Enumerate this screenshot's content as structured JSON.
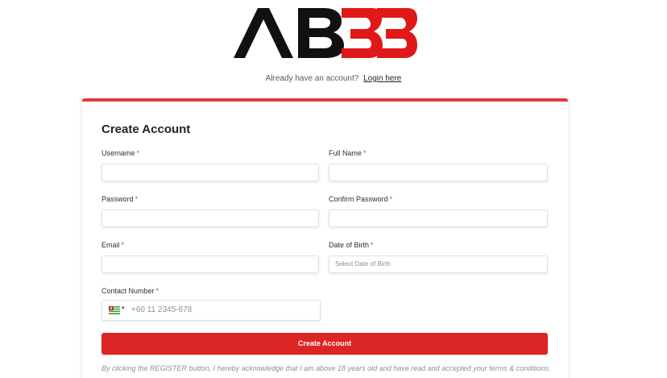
{
  "brand": {
    "logo_text_dark": "AB",
    "logo_text_red": "33"
  },
  "login_prompt": {
    "text": "Already have an account?",
    "link": "Login here"
  },
  "form": {
    "title": "Create Account",
    "fields": {
      "username": {
        "label": "Username",
        "required": "*",
        "value": ""
      },
      "full_name": {
        "label": "Full Name",
        "required": "*",
        "value": ""
      },
      "password": {
        "label": "Password",
        "required": "*",
        "value": ""
      },
      "confirm_password": {
        "label": "Confirm Password",
        "required": "*",
        "value": ""
      },
      "email": {
        "label": "Email",
        "required": "*",
        "value": ""
      },
      "date_of_birth": {
        "label": "Date of Birth",
        "required": "*",
        "placeholder": "Select Date of Birth"
      },
      "contact_number": {
        "label": "Contact Number",
        "required": "*",
        "placeholder": "+60 11 2345-678",
        "caret": "▾"
      }
    },
    "submit_label": "Create Account",
    "disclaimer": "By clicking the REGISTER button, I hereby acknowledge that I am above 18 years old and have read and accepted your terms & conditions."
  },
  "colors": {
    "accent_red": "#dc2626",
    "card_border": "#e03c3c",
    "logo_dark": "#111111"
  }
}
